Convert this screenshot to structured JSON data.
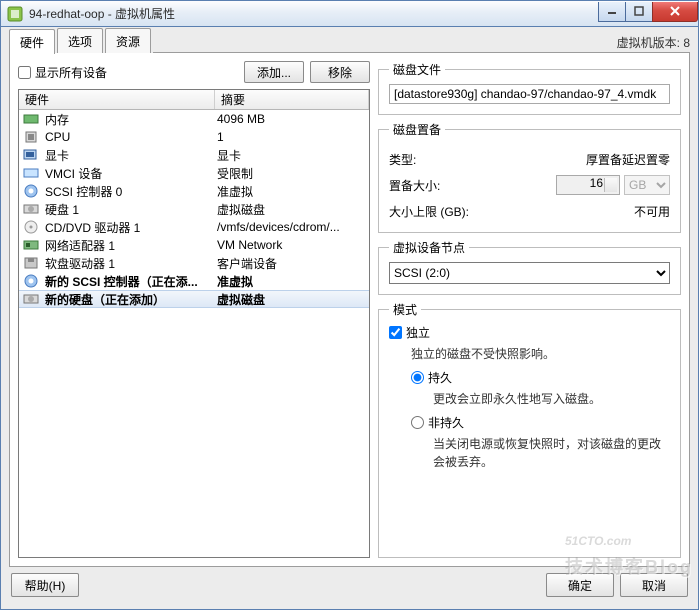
{
  "window": {
    "title": "94-redhat-oop - 虚拟机属性"
  },
  "tabs": {
    "hardware": "硬件",
    "options": "选项",
    "resources": "资源"
  },
  "vmversion_label": "虚拟机版本: 8",
  "toolbar": {
    "show_all": "显示所有设备",
    "add": "添加...",
    "remove": "移除"
  },
  "columns": {
    "hardware": "硬件",
    "summary": "摘要"
  },
  "rows": [
    {
      "icon": "memory",
      "label": "内存",
      "summary": "4096 MB"
    },
    {
      "icon": "cpu",
      "label": "CPU",
      "summary": "1"
    },
    {
      "icon": "video",
      "label": "显卡",
      "summary": "显卡"
    },
    {
      "icon": "vmci",
      "label": "VMCI 设备",
      "summary": "受限制"
    },
    {
      "icon": "scsi",
      "label": "SCSI 控制器 0",
      "summary": "准虚拟"
    },
    {
      "icon": "disk",
      "label": "硬盘 1",
      "summary": "虚拟磁盘"
    },
    {
      "icon": "cd",
      "label": "CD/DVD 驱动器 1",
      "summary": "/vmfs/devices/cdrom/..."
    },
    {
      "icon": "nic",
      "label": "网络适配器 1",
      "summary": "VM Network"
    },
    {
      "icon": "floppy",
      "label": "软盘驱动器 1",
      "summary": "客户端设备"
    },
    {
      "icon": "scsi",
      "label": "新的 SCSI 控制器（正在添...",
      "summary": "准虚拟",
      "bold": true
    },
    {
      "icon": "disk",
      "label": "新的硬盘（正在添加）",
      "summary": "虚拟磁盘",
      "selected": true
    }
  ],
  "diskfile": {
    "legend": "磁盘文件",
    "value": "[datastore930g] chandao-97/chandao-97_4.vmdk"
  },
  "provision": {
    "legend": "磁盘置备",
    "type_k": "类型:",
    "type_v": "厚置备延迟置零",
    "size_k": "置备大小:",
    "size_v": "16",
    "unit": "GB",
    "max_k": "大小上限 (GB):",
    "max_v": "不可用"
  },
  "node": {
    "legend": "虚拟设备节点",
    "value": "SCSI (2:0)"
  },
  "mode": {
    "legend": "模式",
    "independent": "独立",
    "independent_desc": "独立的磁盘不受快照影响。",
    "persistent": "持久",
    "persistent_desc": "更改会立即永久性地写入磁盘。",
    "nonpersistent": "非持久",
    "nonpersistent_desc": "当关闭电源或恢复快照时，对该磁盘的更改会被丢弃。"
  },
  "buttons": {
    "help": "帮助(H)",
    "ok": "确定",
    "cancel": "取消"
  },
  "watermark": {
    "main": "51CTO.com",
    "sub": "技术博客Blog"
  }
}
